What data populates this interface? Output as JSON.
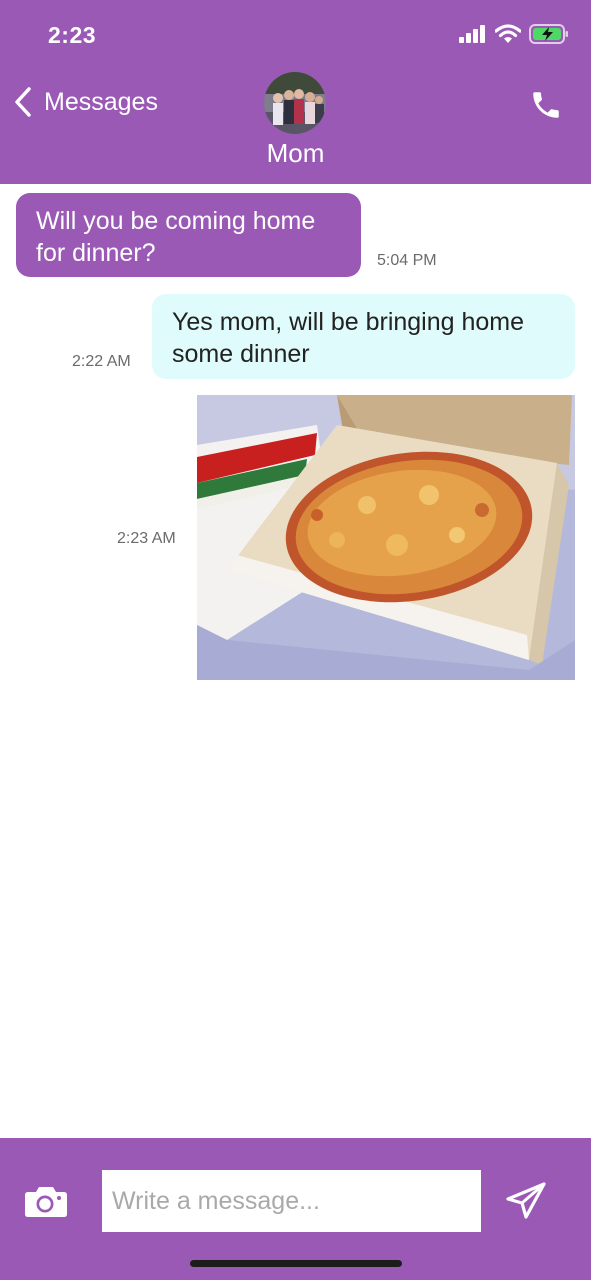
{
  "theme": {
    "header_color": "#9b59b6",
    "incoming_bubble": "#9b59b6",
    "outgoing_bubble": "#e0fbfb"
  },
  "status_bar": {
    "time": "2:23"
  },
  "header": {
    "back_label": "Messages",
    "contact_name": "Mom",
    "icons": [
      "chevron-left-icon",
      "phone-icon"
    ]
  },
  "messages": [
    {
      "direction": "incoming",
      "text": "Will you be coming home for dinner?",
      "time": "5:04 PM"
    },
    {
      "direction": "outgoing",
      "text": "Yes mom, will be bringing home some dinner",
      "time": "2:22 AM"
    },
    {
      "direction": "outgoing",
      "type": "image",
      "image_label": "pizza in a box",
      "time": "2:23 AM"
    }
  ],
  "composer": {
    "placeholder": "Write a message...",
    "icons": [
      "camera-icon",
      "send-icon"
    ]
  }
}
